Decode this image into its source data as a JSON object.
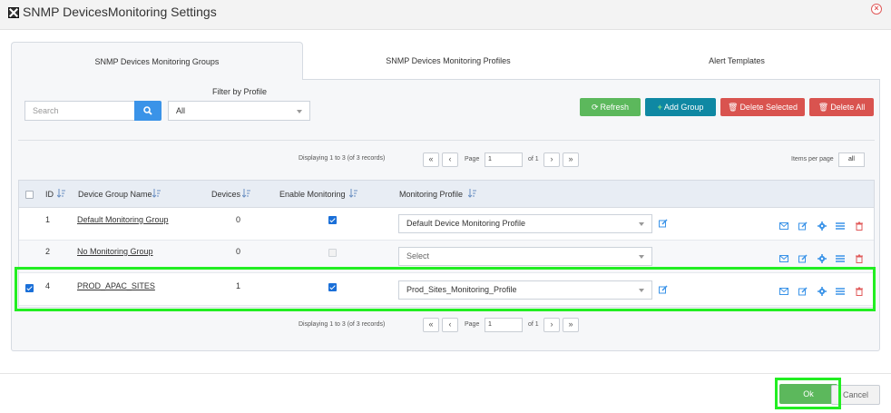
{
  "window": {
    "title": "SNMP DevicesMonitoring Settings"
  },
  "tabs": [
    {
      "label": "SNMP Devices Monitoring Groups",
      "active": true
    },
    {
      "label": "SNMP Devices Monitoring Profiles",
      "active": false
    },
    {
      "label": "Alert Templates",
      "active": false
    }
  ],
  "toolbar": {
    "search_placeholder": "Search",
    "filter_label": "Filter by Profile",
    "filter_value": "All",
    "refresh_label": "Refresh",
    "add_group_label": "Add Group",
    "delete_selected_label": "Delete Selected",
    "delete_all_label": "Delete All"
  },
  "pager": {
    "displaying": "Displaying 1 to 3 (of 3 records)",
    "page_label": "Page",
    "page_value": "1",
    "of_label": "of 1",
    "items_per_page_label": "Items per page",
    "items_per_page_value": "all"
  },
  "table": {
    "columns": [
      "ID",
      "Device Group Name",
      "Devices",
      "Enable Monitoring",
      "Monitoring Profile"
    ],
    "rows": [
      {
        "id": "1",
        "name": "Default Monitoring Group",
        "devices": "0",
        "enabled": true,
        "profile": "Default Device Monitoring Profile",
        "selected": false
      },
      {
        "id": "2",
        "name": "No Monitoring Group",
        "devices": "0",
        "enabled": false,
        "profile": "Select",
        "selected": false
      },
      {
        "id": "4",
        "name": "PROD_APAC_SITES",
        "devices": "1",
        "enabled": true,
        "profile": "Prod_Sites_Monitoring_Profile",
        "selected": true
      }
    ]
  },
  "footer": {
    "ok_label": "Ok",
    "cancel_label": "Cancel"
  },
  "colors": {
    "green": "#5cb85c",
    "teal": "#0f88a3",
    "red": "#d9534f",
    "blue": "#3a93e8",
    "highlight": "#22ee22"
  }
}
